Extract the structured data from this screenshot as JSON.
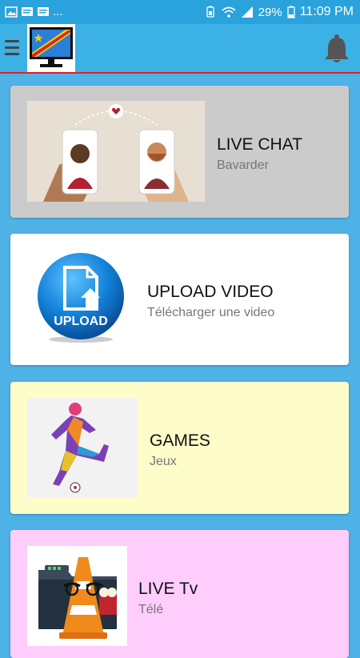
{
  "status_bar": {
    "notification_dots": "...",
    "battery_percent": "29%",
    "time": "11:09 PM"
  },
  "app_bar": {
    "menu_icon": "hamburger-icon",
    "logo_icon": "tv-flag-logo",
    "bell_icon": "bell-icon"
  },
  "cards": [
    {
      "title": "LIVE CHAT",
      "subtitle": "Bavarder",
      "image": "chat-couple-phones",
      "bg": "#cbcbcb"
    },
    {
      "title": "UPLOAD VIDEO",
      "subtitle": "Télécharger une video",
      "image": "upload-icon",
      "bg": "#ffffff",
      "image_text": "UPLOAD"
    },
    {
      "title": "GAMES",
      "subtitle": "Jeux",
      "image": "soccer-player",
      "bg": "#fefcc9"
    },
    {
      "title": "LIVE Tv",
      "subtitle": "Télé",
      "image": "vlc-folder",
      "bg": "#fecdfc"
    }
  ],
  "colors": {
    "status_bar": "#2aa2dc",
    "app_bar": "#3cb1e6",
    "accent_line": "#d9232d",
    "background": "#4fb3e8"
  }
}
